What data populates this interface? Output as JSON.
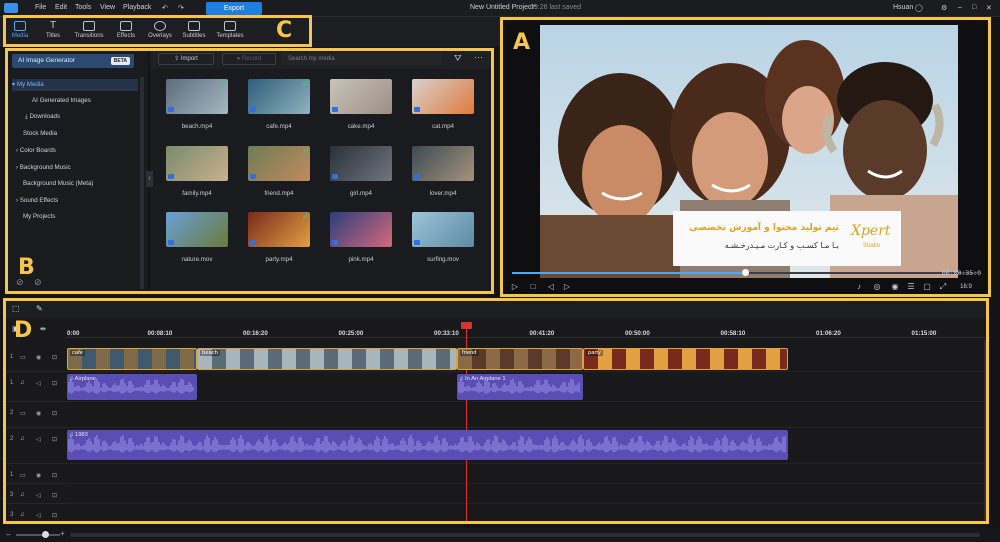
{
  "menu": {
    "items": [
      "File",
      "Edit",
      "Tools",
      "View",
      "Playback"
    ],
    "export": "Export",
    "project_title": "New Untitled Project*",
    "saved_status": "09:26 last saved",
    "user": "Hsuan"
  },
  "toolbar": {
    "tabs": [
      "Media",
      "Titles",
      "Transitions",
      "Effects",
      "Overlays",
      "Subtitles",
      "Templates"
    ]
  },
  "library": {
    "ai_generator": "AI Image Generator",
    "beta": "BETA",
    "items": [
      "My Media",
      "AI Generated Images",
      "Downloads",
      "Stock Media",
      "Color Boards",
      "Background Music",
      "Background Music (Meta)",
      "Sound Effects",
      "My Projects"
    ]
  },
  "media_toolbar": {
    "import": "Import",
    "record": "Record",
    "search_placeholder": "Search my media"
  },
  "media": [
    {
      "name": "beach.mp4",
      "used": true
    },
    {
      "name": "cafe.mp4",
      "used": true
    },
    {
      "name": "cake.mp4",
      "used": false
    },
    {
      "name": "cat.mp4",
      "used": false
    },
    {
      "name": "family.mp4",
      "used": false
    },
    {
      "name": "friend.mp4",
      "used": true
    },
    {
      "name": "girl.mp4",
      "used": false
    },
    {
      "name": "lover.mp4",
      "used": false
    },
    {
      "name": "nature.mov",
      "used": false
    },
    {
      "name": "party.mp4",
      "used": true
    },
    {
      "name": "pink.mp4",
      "used": false
    },
    {
      "name": "surfing.mov",
      "used": false
    }
  ],
  "preview": {
    "timecode": "00:00:35:0",
    "zoom": "16:9",
    "logo_line1": "تیم تولید محتوا و آموزش تخصصی",
    "logo_line2": "بـا مـا کسـب و کـارت مـیـدرخـشـه",
    "logo_brand": "Xpert",
    "logo_sub": "Studio",
    "progress": 0.5
  },
  "timeline": {
    "ticks": [
      "0:00",
      "00:08:10",
      "00:16:20",
      "00:25:00",
      "00:33:10",
      "00:41:20",
      "00:50:00",
      "00:58:10",
      "01:06:20",
      "01:15:00"
    ],
    "tracks": [
      "1",
      "1",
      "2",
      "2",
      "2",
      "1",
      "3",
      "3"
    ],
    "video_clips": [
      {
        "label": "cafe"
      },
      {
        "label": "beach"
      },
      {
        "label": "friend"
      },
      {
        "label": "party"
      }
    ],
    "audio_clips": [
      {
        "label": "Airplane"
      },
      {
        "label": "In An Airplane 1"
      },
      {
        "label": "1983"
      }
    ]
  },
  "annotations": [
    "A",
    "B",
    "C",
    "D"
  ],
  "colors": {
    "accent": "#1e7fe0",
    "annotation": "#f6c54b",
    "playhead": "#d8332f",
    "audio": "#5a4db3"
  }
}
